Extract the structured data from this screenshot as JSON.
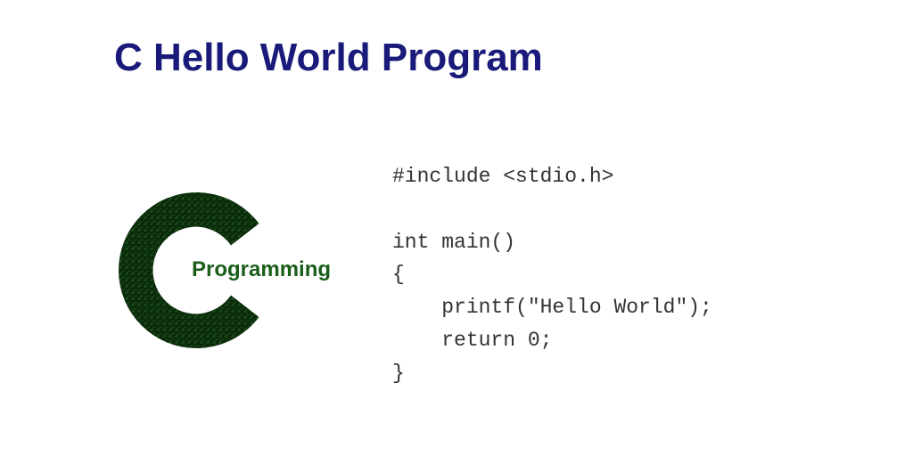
{
  "title": "C Hello World Program",
  "logo": {
    "label": "Programming"
  },
  "code": {
    "line1": "#include <stdio.h>",
    "line2": "",
    "line3": "int main()",
    "line4": "{",
    "line5": "    printf(\"Hello World\");",
    "line6": "    return 0;",
    "line7": "}"
  }
}
